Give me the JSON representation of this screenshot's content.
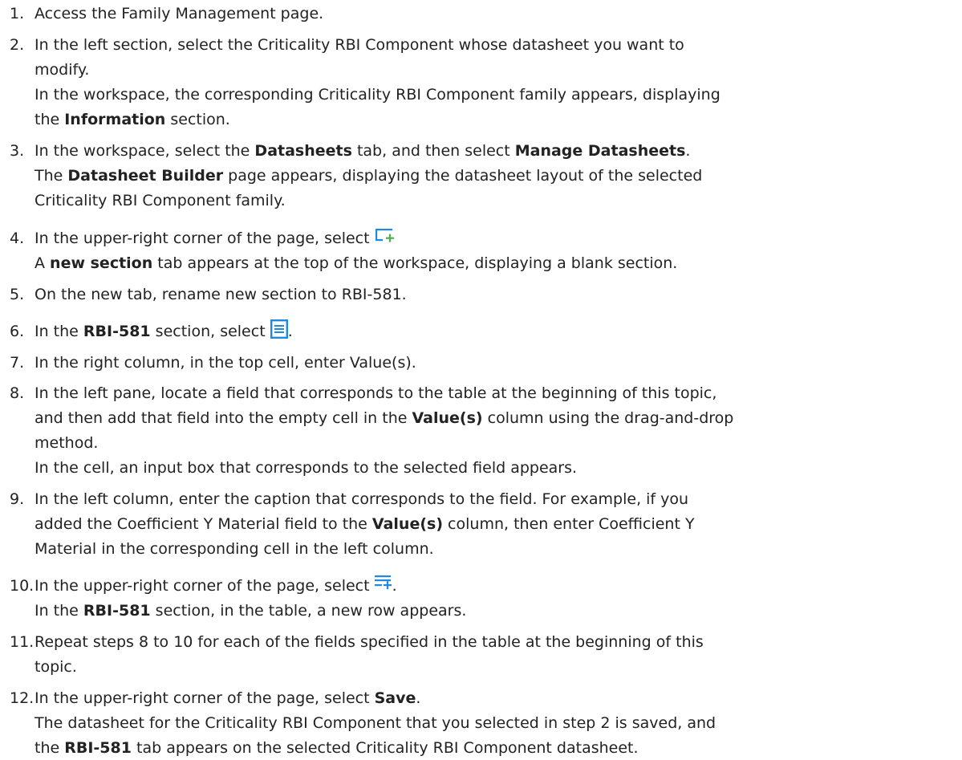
{
  "steps": [
    {
      "number": "1.",
      "lines": [
        {
          "parts": [
            "Access the Family Management page."
          ]
        }
      ]
    },
    {
      "number": "2.",
      "lines": [
        {
          "parts": [
            "In the left section, select the Criticality RBI Component whose datasheet you want to"
          ]
        },
        {
          "parts": [
            "modify."
          ]
        },
        {
          "parts": [
            "In the workspace, the corresponding Criticality RBI Component family appears, displaying"
          ]
        },
        {
          "parts": [
            "the ",
            "Information",
            " section."
          ]
        }
      ]
    },
    {
      "number": "3.",
      "lines": [
        {
          "parts": [
            "In the workspace, select the ",
            "Datasheets",
            " tab, and then select ",
            "Manage Datasheets",
            "."
          ]
        },
        {
          "parts": [
            "The ",
            "Datasheet Builder",
            " page appears, displaying the datasheet layout of the selected"
          ]
        },
        {
          "parts": [
            "Criticality RBI Component family."
          ]
        }
      ]
    },
    {
      "number": "4.",
      "lines": [
        {
          "parts": [
            "In the upper-right corner of the page, select "
          ]
        },
        {
          "parts": [
            "A ",
            "new section",
            " tab appears at the top of the workspace, displaying a blank section."
          ]
        }
      ]
    },
    {
      "number": "5.",
      "lines": [
        {
          "parts": [
            "On the new tab, rename new section to RBI-581."
          ]
        }
      ]
    },
    {
      "number": "6.",
      "lines": [
        {
          "parts": [
            "In the ",
            "RBI-581",
            " section, select ",
            "."
          ]
        }
      ]
    },
    {
      "number": "7.",
      "lines": [
        {
          "parts": [
            "In the right column, in the top cell, enter Value(s)."
          ]
        }
      ]
    },
    {
      "number": "8.",
      "lines": [
        {
          "parts": [
            "In the left pane, locate a field that corresponds to the table at the beginning of this topic,"
          ]
        },
        {
          "parts": [
            "and then add that field into the empty cell in the ",
            "Value(s)",
            " column using the drag-and-drop"
          ]
        },
        {
          "parts": [
            "method."
          ]
        },
        {
          "parts": [
            "In the cell, an input box that corresponds to the selected field appears."
          ]
        }
      ]
    },
    {
      "number": "9.",
      "lines": [
        {
          "parts": [
            "In the left column, enter the caption that corresponds to the field. For example, if you"
          ]
        },
        {
          "parts": [
            "added the Coefficient Y Material field to the ",
            "Value(s)",
            " column, then enter Coefficient Y"
          ]
        },
        {
          "parts": [
            "Material in the corresponding cell in the left column."
          ]
        }
      ]
    },
    {
      "number": "10.",
      "lines": [
        {
          "parts": [
            "In the upper-right corner of the page, select ",
            "."
          ]
        },
        {
          "parts": [
            "In the ",
            "RBI-581",
            " section, in the table, a new row appears."
          ]
        }
      ]
    },
    {
      "number": "11.",
      "lines": [
        {
          "parts": [
            "Repeat steps 8 to 10 for each of the fields specified in the table at the beginning of this"
          ]
        },
        {
          "parts": [
            "topic."
          ]
        }
      ]
    },
    {
      "number": "12.",
      "lines": [
        {
          "parts": [
            "In the upper-right corner of the page, select ",
            "Save",
            "."
          ]
        },
        {
          "parts": [
            "The datasheet for the Criticality RBI Component that you selected in step 2 is saved, and"
          ]
        },
        {
          "parts": [
            "the ",
            "RBI-581",
            " tab appears on the selected Criticality RBI Component datasheet."
          ]
        }
      ]
    }
  ],
  "icons": {
    "add_section": "add-section-icon",
    "table_layout": "table-layout-icon",
    "add_row": "add-row-icon"
  },
  "colors": {
    "text": "#222222",
    "icon_blue": "#1e88e5"
  }
}
